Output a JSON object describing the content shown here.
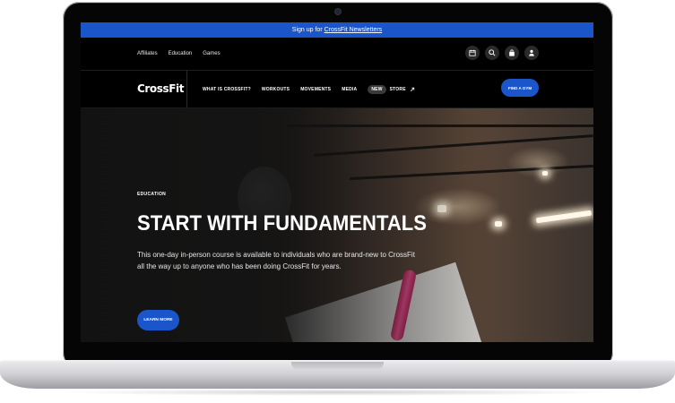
{
  "promo": {
    "prefix": "Sign up for ",
    "link": "CrossFit Newsletters"
  },
  "utility_nav": {
    "links": [
      "Affiliates",
      "Education",
      "Games"
    ]
  },
  "utility_icons": [
    "calendar-icon",
    "search-icon",
    "shopping-bag-icon",
    "user-icon"
  ],
  "main_nav": {
    "logo": "CrossFit",
    "links": [
      "WHAT IS CROSSFIT?",
      "WORKOUTS",
      "MOVEMENTS",
      "MEDIA"
    ],
    "badge": "NEW",
    "store": "STORE",
    "store_icon": "external-arrow-icon",
    "cta": "FIND A GYM"
  },
  "hero": {
    "eyebrow": "EDUCATION",
    "title": "START WITH FUNDAMENTALS",
    "body": "This one-day in-person course is available to individuals who are brand-new to CrossFit all the way up to anyone who has been doing CrossFit for years.",
    "cta": "LEARN MORE"
  },
  "colors": {
    "accent": "#1a56c9",
    "background": "#000000",
    "text": "#ffffff"
  }
}
